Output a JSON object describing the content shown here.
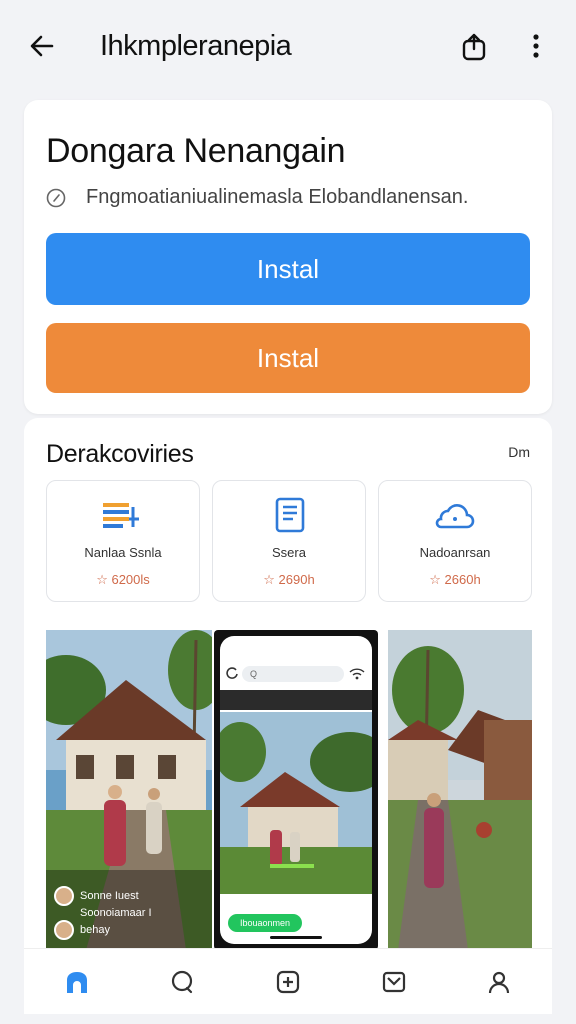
{
  "header": {
    "title": "Ihkmpleranepia"
  },
  "app": {
    "name": "Dongara Nenangain",
    "description": "Fngmoatianiualinemasla Elobandlanensan.",
    "install_primary": "Instal",
    "install_secondary": "Instal"
  },
  "discover": {
    "title": "Derakcoviries",
    "more": "Dm",
    "tiles": [
      {
        "label": "Nanlaa Ssnla",
        "count": "☆ 6200ls",
        "icon": "list-edit-icon"
      },
      {
        "label": "Ssera",
        "count": "☆ 2690h",
        "icon": "document-icon"
      },
      {
        "label": "Nadoanrsan",
        "count": "☆ 2660h",
        "icon": "cloud-icon"
      }
    ]
  },
  "media": {
    "caption_line1": "Sonne Iuest",
    "caption_line2": "Soonoiamaar I",
    "caption_line3": "behay",
    "phone_url": "Q",
    "phone_cta": "Ibouaonmen"
  },
  "nav": {
    "items": [
      "home-icon",
      "chat-icon",
      "add-icon",
      "inbox-icon",
      "profile-icon"
    ]
  },
  "colors": {
    "primary": "#2f8cf0",
    "secondary": "#ee8a3a",
    "accent": "#d06a4a"
  }
}
